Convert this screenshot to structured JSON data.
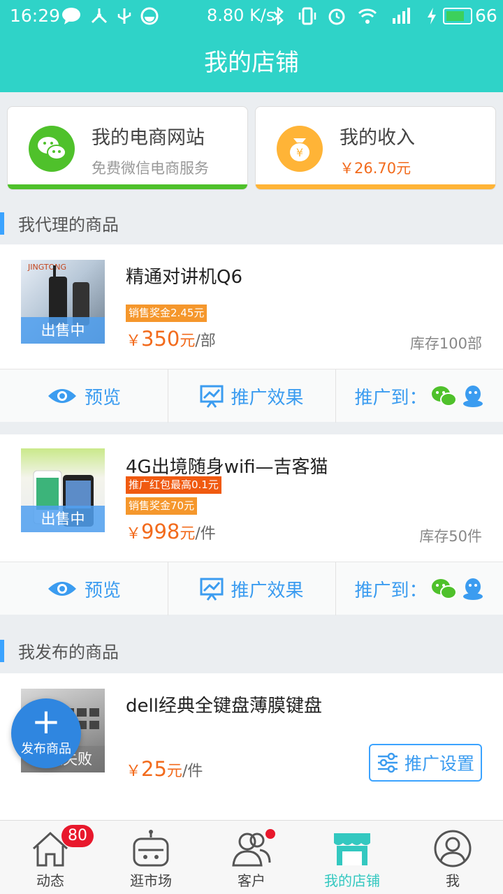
{
  "status_bar": {
    "time": "16:29",
    "net_speed": "8.80 K/s",
    "battery": "66"
  },
  "header": {
    "title": "我的店铺"
  },
  "cards": {
    "site": {
      "title": "我的电商网站",
      "subtitle": "免费微信电商服务",
      "accent": "#4fc12b"
    },
    "income": {
      "title": "我的收入",
      "amount": "￥26.70元",
      "accent": "#ffb437"
    }
  },
  "sections": {
    "agent": "我代理的商品",
    "published": "我发布的商品"
  },
  "products": [
    {
      "name": "精通对讲机Q6",
      "status": "出售中",
      "tags": [
        "销售奖金2.45元"
      ],
      "currency": "￥",
      "price": "350",
      "price_unit": "元",
      "unit": "/部",
      "stock": "库存100部"
    },
    {
      "name": "4G出境随身wifi—吉客猫",
      "status": "出售中",
      "tags": [
        "推广红包最高0.1元",
        "销售奖金70元"
      ],
      "currency": "￥",
      "price": "998",
      "price_unit": "元",
      "unit": "/件",
      "stock": "库存50件"
    },
    {
      "name": "dell经典全键盘薄膜键盘",
      "status": "审核失败",
      "currency": "￥",
      "price": "25",
      "price_unit": "元",
      "unit": "/件",
      "button": "推广设置"
    }
  ],
  "actions": {
    "preview": "预览",
    "effect": "推广效果",
    "promote_to": "推广到："
  },
  "fab": {
    "label": "发布商品"
  },
  "tabbar": {
    "items": [
      {
        "label": "动态",
        "badge": "80"
      },
      {
        "label": "逛市场"
      },
      {
        "label": "客户"
      },
      {
        "label": "我的店铺"
      },
      {
        "label": "我"
      }
    ],
    "active": "我的店铺",
    "active_color": "#33c8c0"
  },
  "colors": {
    "primary": "#2fd3c8",
    "accent_blue": "#3b9cf0",
    "price_orange": "#f26b1d"
  }
}
